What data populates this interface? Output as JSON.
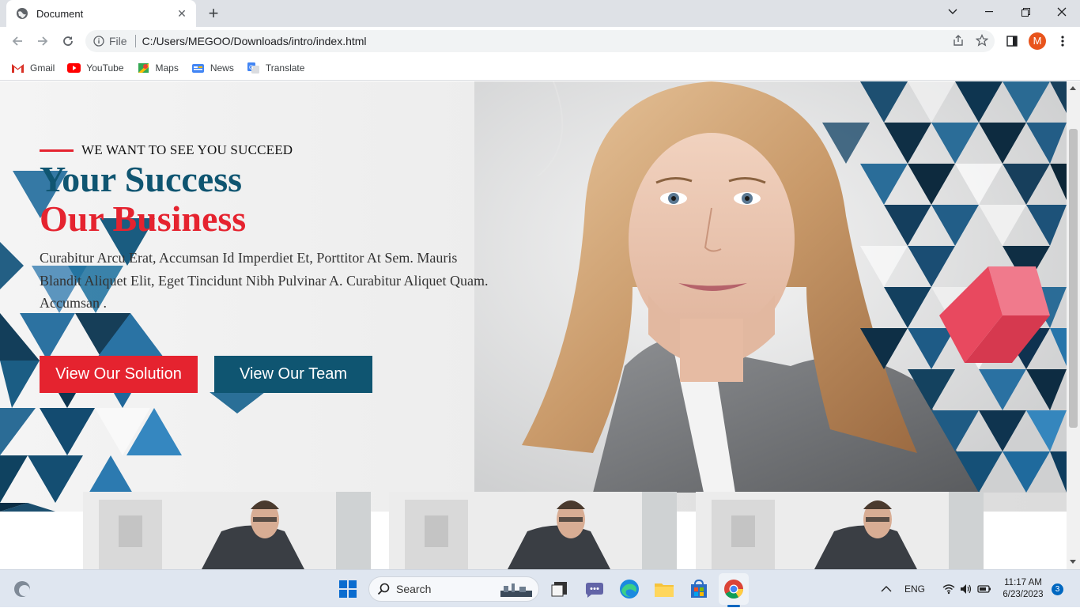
{
  "browser": {
    "tab_title": "Document",
    "url_scheme_label": "File",
    "url": "C:/Users/MEGOO/Downloads/intro/index.html",
    "profile_initial": "M",
    "bookmarks": [
      {
        "label": "Gmail",
        "icon": "gmail-icon"
      },
      {
        "label": "YouTube",
        "icon": "youtube-icon"
      },
      {
        "label": "Maps",
        "icon": "maps-icon"
      },
      {
        "label": "News",
        "icon": "news-icon"
      },
      {
        "label": "Translate",
        "icon": "translate-icon"
      }
    ]
  },
  "hero": {
    "eyebrow": "WE WANT TO SEE YOU SUCCEED",
    "headline_line1": "Your Success",
    "headline_line2": "Our Business",
    "intro": "Curabitur Arcu Erat, Accumsan Id Imperdiet Et, Porttitor At Sem. Mauris Blandit Aliquet Elit, Eget Tincidunt Nibh Pulvinar A. Curabitur Aliquet Quam. Accumsan .",
    "primary_button": "View Our Solution",
    "secondary_button": "View Our Team"
  },
  "colors": {
    "accent_red": "#e5232f",
    "brand_blue": "#0f5571"
  },
  "taskbar": {
    "search_label": "Search",
    "language": "ENG",
    "time": "11:17 AM",
    "date": "6/23/2023",
    "notification_count": "3"
  }
}
